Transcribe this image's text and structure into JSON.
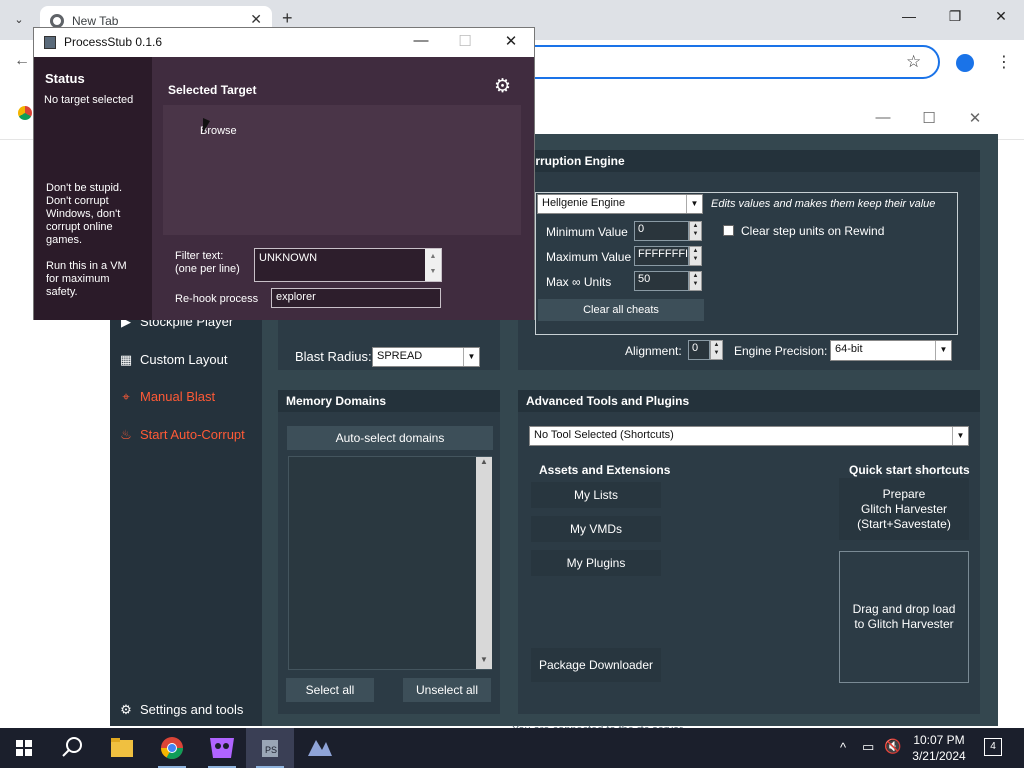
{
  "browser": {
    "tab_title": "New Tab",
    "new_tab": "+",
    "tab_close": "✕",
    "minimize": "—",
    "maximize": "❐",
    "close": "✕"
  },
  "rtc": {
    "sidebar": {
      "stockpile_player": "Stockpile Player",
      "custom_layout": "Custom Layout",
      "manual_blast": "Manual Blast",
      "auto_corrupt": "Start Auto-Corrupt",
      "settings": "Settings and tools"
    },
    "blast_radius_label": "Blast Radius:",
    "blast_radius_value": "SPREAD",
    "corruption_engine": {
      "header": "orruption Engine",
      "engine_value": "Hellgenie Engine",
      "engine_desc": "Edits values and makes them keep their value",
      "min_label": "Minimum Value",
      "min_value": "0",
      "max_label": "Maximum Value",
      "max_value": "FFFFFFFI",
      "units_label": "Max ∞ Units",
      "units_value": "50",
      "clear_step_label": "Clear step units on Rewind",
      "clear_cheats": "Clear all cheats",
      "alignment_label": "Alignment:",
      "alignment_value": "0",
      "precision_label": "Engine Precision:",
      "precision_value": "64-bit"
    },
    "memory_domains": {
      "header": "Memory Domains",
      "auto_select": "Auto-select domains",
      "select_all": "Select all",
      "unselect_all": "Unselect all"
    },
    "advanced_tools": {
      "header": "Advanced Tools and Plugins",
      "tool_select": "No Tool Selected (Shortcuts)",
      "assets_header": "Assets and Extensions",
      "my_lists": "My Lists",
      "my_vmds": "My VMDs",
      "my_plugins": "My Plugins",
      "package_downloader": "Package Downloader",
      "quick_start_header": "Quick start shortcuts",
      "prepare_line1": "Prepare",
      "prepare_line2": "Glitch Harvester",
      "prepare_line3": "(Start+Savestate)",
      "drag_drop_line1": "Drag and drop load",
      "drag_drop_line2": "to Glitch Harvester"
    },
    "status_line": "You are connected to the rtc server"
  },
  "processstub": {
    "title": "ProcessStub 0.1.6",
    "status_header": "Status",
    "status_value": "No target selected",
    "warning": [
      "Don't be stupid.",
      "Don't corrupt",
      "Windows, don't",
      "corrupt online",
      "games."
    ],
    "vm_note": [
      "Run this in a VM",
      "for maximum",
      "safety."
    ],
    "selected_target": "Selected Target",
    "browse": "Browse",
    "filter_label_1": "Filter text:",
    "filter_label_2": "(one per line)",
    "filter_value": "UNKNOWN",
    "rehook_label": "Re-hook process",
    "rehook_value": "explorer"
  },
  "taskbar": {
    "time": "10:07 PM",
    "date": "3/21/2024",
    "notification_count": "4"
  }
}
